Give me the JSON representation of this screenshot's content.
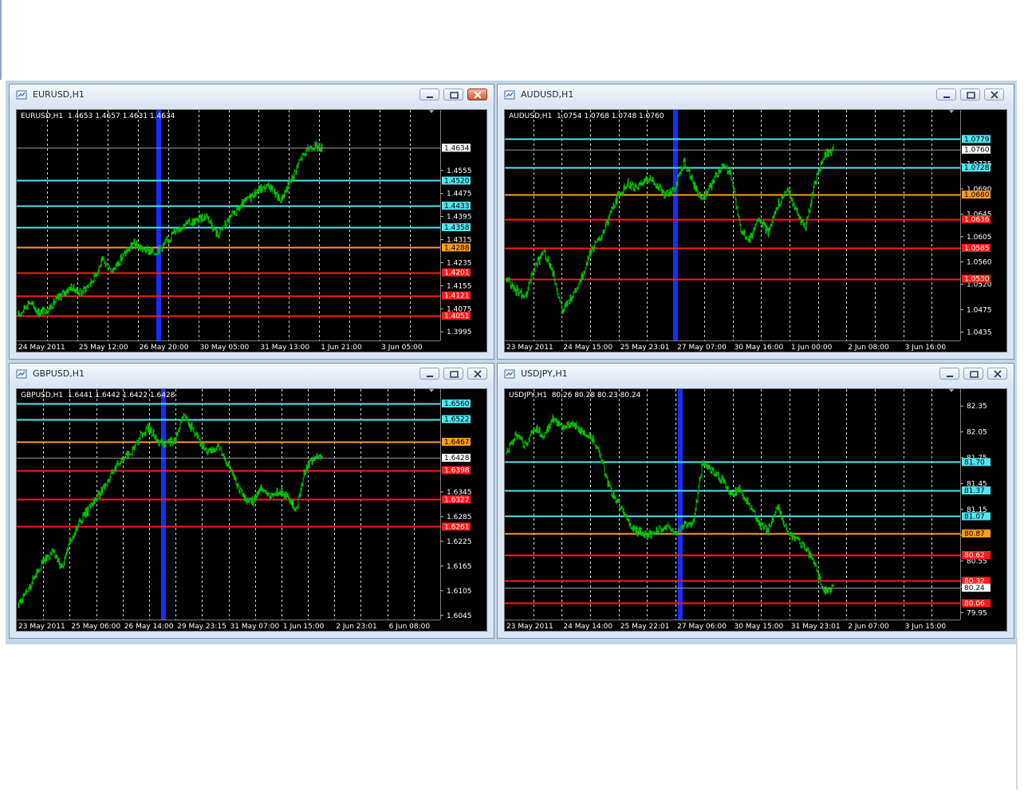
{
  "colors": {
    "background": "#000000",
    "candles": "#00c000",
    "grid": "#d0d0d0",
    "cyan": "#4fe6f0",
    "orange": "#ff9c1a",
    "red": "#ff1a1a",
    "blue_band": "#1a2bff",
    "price_label_bg": "#ffffff"
  },
  "windows": {
    "eurusd": {
      "title": "EURUSD,H1",
      "header_symbol": "EURUSD,H1",
      "header_ohlc": "1.4653 1.4657 1.4631 1.4634",
      "chart_data": {
        "type": "candlestick",
        "y_ticks": [
          "1.4555",
          "1.4475",
          "1.4395",
          "1.4315",
          "1.4235",
          "1.4155",
          "1.4075",
          "1.3995"
        ],
        "x_ticks": [
          "24 May 2011",
          "25 May 12:00",
          "26 May 20:00",
          "30 May 05:00",
          "31 May 13:00",
          "1 Jun 21:00",
          "3 Jun 05:00"
        ],
        "ylim": [
          1.3965,
          1.4715
        ],
        "current_price": "1.4634",
        "levels": [
          {
            "value": "1.4520",
            "color": "cyan"
          },
          {
            "value": "1.4433",
            "color": "cyan"
          },
          {
            "value": "1.4358",
            "color": "cyan"
          },
          {
            "value": "1.4288",
            "color": "orange"
          },
          {
            "value": "1.4201",
            "color": "red"
          },
          {
            "value": "1.4121",
            "color": "red"
          },
          {
            "value": "1.4051",
            "color": "red"
          }
        ],
        "close_path": [
          1.405,
          1.41,
          1.406,
          1.408,
          1.412,
          1.415,
          1.413,
          1.417,
          1.424,
          1.421,
          1.426,
          1.43,
          1.428,
          1.427,
          1.43,
          1.435,
          1.437,
          1.438,
          1.44,
          1.433,
          1.438,
          1.442,
          1.446,
          1.449,
          1.45,
          1.445,
          1.452,
          1.46,
          1.464,
          1.4634
        ]
      }
    },
    "audusd": {
      "title": "AUDUSD,H1",
      "header_symbol": "AUDUSD,H1",
      "header_ohlc": "1.0754 1.0768 1.0748 1.0760",
      "chart_data": {
        "type": "candlestick",
        "y_ticks": [
          "1.0735",
          "1.0690",
          "1.0645",
          "1.0605",
          "1.0560",
          "1.0520",
          "1.0475",
          "1.0435"
        ],
        "x_ticks": [
          "23 May 2011",
          "24 May 15:00",
          "25 May 23:01",
          "27 May 07:00",
          "30 May 16:00",
          "1 Jun 00:00",
          "2 Jun 08:00",
          "3 Jun 16:00"
        ],
        "ylim": [
          1.042,
          1.0805
        ],
        "current_price": "1.0760",
        "levels": [
          {
            "value": "1.0779",
            "color": "cyan"
          },
          {
            "value": "1.0728",
            "color": "cyan"
          },
          {
            "value": "1.0680",
            "color": "orange"
          },
          {
            "value": "1.0636",
            "color": "red"
          },
          {
            "value": "1.0585",
            "color": "red"
          },
          {
            "value": "1.0530",
            "color": "red"
          }
        ],
        "close_path": [
          1.053,
          1.051,
          1.05,
          1.055,
          1.058,
          1.054,
          1.047,
          1.05,
          1.053,
          1.058,
          1.06,
          1.064,
          1.068,
          1.07,
          1.069,
          1.071,
          1.07,
          1.068,
          1.069,
          1.074,
          1.07,
          1.067,
          1.07,
          1.073,
          1.072,
          1.062,
          1.06,
          1.064,
          1.061,
          1.066,
          1.069,
          1.065,
          1.062,
          1.07,
          1.075,
          1.076
        ]
      }
    },
    "gbpusd": {
      "title": "GBPUSD,H1",
      "header_symbol": "GBPUSD,H1",
      "header_ohlc": "1.6441 1.6442 1.6422 1.6428",
      "chart_data": {
        "type": "candlestick",
        "y_ticks": [
          "1.6345",
          "1.6285",
          "1.6225",
          "1.6165",
          "1.6105",
          "1.6045"
        ],
        "x_ticks": [
          "23 May 2011",
          "25 May 06:00",
          "26 May 14:00",
          "29 May 23:15",
          "31 May 07:00",
          "1 Jun 15:00",
          "2 Jun 23:01",
          "6 Jun 08:00"
        ],
        "ylim": [
          1.6035,
          1.656
        ],
        "current_price": "1.6428",
        "levels": [
          {
            "value": "1.6560",
            "color": "cyan"
          },
          {
            "value": "1.6522",
            "color": "cyan"
          },
          {
            "value": "1.6467",
            "color": "orange"
          },
          {
            "value": "1.6398",
            "color": "red"
          },
          {
            "value": "1.6327",
            "color": "red"
          },
          {
            "value": "1.6261",
            "color": "red"
          }
        ],
        "close_path": [
          1.607,
          1.61,
          1.615,
          1.618,
          1.62,
          1.616,
          1.623,
          1.627,
          1.63,
          1.633,
          1.636,
          1.64,
          1.643,
          1.644,
          1.648,
          1.65,
          1.647,
          1.646,
          1.647,
          1.653,
          1.65,
          1.646,
          1.644,
          1.646,
          1.642,
          1.637,
          1.633,
          1.632,
          1.636,
          1.633,
          1.635,
          1.633,
          1.63,
          1.64,
          1.643,
          1.6428
        ]
      }
    },
    "usdjpy": {
      "title": "USDJPY,H1",
      "header_symbol": "USDJPY,H1",
      "header_ohlc": "80.26 80.28 80.23 80.24",
      "chart_data": {
        "type": "candlestick",
        "y_ticks": [
          "82.35",
          "82.05",
          "81.75",
          "81.45",
          "81.15",
          "80.85",
          "80.55",
          "80.25",
          "79.95"
        ],
        "x_ticks": [
          "23 May 2011",
          "24 May 14:00",
          "25 May 22:01",
          "27 May 06:00",
          "30 May 15:00",
          "31 May 23:01",
          "2 Jun 07:00",
          "3 Jun 15:00"
        ],
        "ylim": [
          79.87,
          82.38
        ],
        "current_price": "80.24",
        "levels": [
          {
            "value": "81.70",
            "color": "cyan"
          },
          {
            "value": "81.37",
            "color": "cyan"
          },
          {
            "value": "81.07",
            "color": "cyan"
          },
          {
            "value": "80.87",
            "color": "orange"
          },
          {
            "value": "80.62",
            "color": "red"
          },
          {
            "value": "80.32",
            "color": "red"
          },
          {
            "value": "80.06",
            "color": "red"
          }
        ],
        "close_path": [
          81.8,
          82.0,
          81.9,
          82.1,
          82.0,
          82.2,
          82.1,
          82.15,
          82.05,
          82.0,
          81.8,
          81.4,
          81.2,
          81.0,
          80.9,
          80.85,
          80.9,
          80.95,
          80.9,
          80.95,
          81.0,
          81.7,
          81.6,
          81.5,
          81.3,
          81.4,
          81.2,
          81.0,
          80.9,
          81.2,
          80.9,
          80.8,
          80.7,
          80.5,
          80.2,
          80.24
        ]
      }
    }
  }
}
